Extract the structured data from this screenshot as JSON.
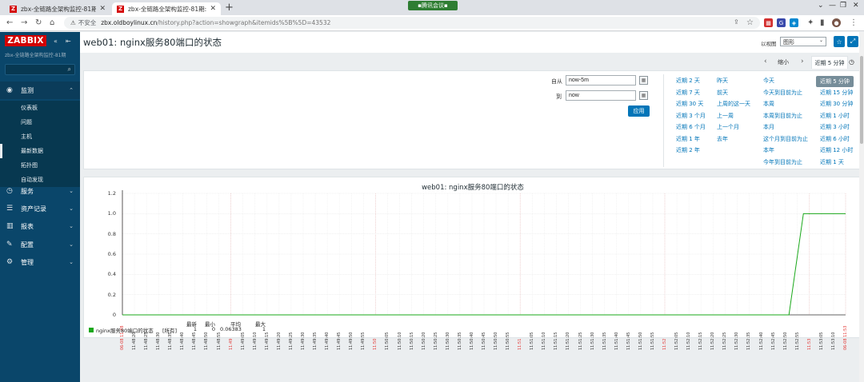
{
  "browser": {
    "tabs": [
      {
        "title": "zbx-全链路全架构监控-81期: 图...",
        "active": false
      },
      {
        "title": "zbx-全链路全架构监控-81期: 图...",
        "active": true
      }
    ],
    "meeting_label": "腾讯会议",
    "insecure_label": "不安全",
    "url_host": "zbx.oldboylinux.cn",
    "url_rest": "/history.php?action=showgraph&itemids%5B%5D=43532",
    "favicon_letter": "Z"
  },
  "sidebar": {
    "logo": "ZABBIX",
    "org": "zbx-全链路全架构监控-81期",
    "menu": [
      {
        "label": "监测",
        "icon": "eye-icon",
        "open": true
      },
      {
        "label": "服务",
        "icon": "clock-icon"
      },
      {
        "label": "资产记录",
        "icon": "list-icon"
      },
      {
        "label": "报表",
        "icon": "bar-chart-icon"
      },
      {
        "label": "配置",
        "icon": "wrench-icon"
      },
      {
        "label": "管理",
        "icon": "gear-icon"
      }
    ],
    "submenu": [
      {
        "label": "仪表板"
      },
      {
        "label": "问题"
      },
      {
        "label": "主机"
      },
      {
        "label": "最新数据",
        "selected": true
      },
      {
        "label": "拓扑图"
      },
      {
        "label": "自动发现"
      }
    ]
  },
  "header": {
    "title": "web01: nginx服务80端口的状态",
    "view_as_label": "以视图",
    "view_as_value": "图形"
  },
  "timenav": {
    "zoom_out": "缩小",
    "active_tab": "近期 5 分钟"
  },
  "filter": {
    "from_label": "自从",
    "from_value": "now-5m",
    "to_label": "到",
    "to_value": "now",
    "apply": "应用",
    "quick_ranges": [
      [
        "近期 2 天",
        "近期 7 天",
        "近期 30 天",
        "近期 3 个月",
        "近期 6 个月",
        "近期 1 年",
        "近期 2 年"
      ],
      [
        "昨天",
        "前天",
        "上周的这一天",
        "上一周",
        "上一个月",
        "去年"
      ],
      [
        "今天",
        "今天到目前为止",
        "本周",
        "本周到目前为止",
        "本月",
        "这个月到目前为止",
        "本年",
        "今年到目前为止"
      ],
      [
        "近期 5 分钟",
        "近期 15 分钟",
        "近期 30 分钟",
        "近期 1 小时",
        "近期 3 小时",
        "近期 6 小时",
        "近期 12 小时",
        "近期 1 天"
      ]
    ],
    "selected_quick": "近期 5 分钟"
  },
  "chart_data": {
    "type": "line",
    "title": "web01: nginx服务80端口的状态",
    "ylim": [
      0,
      1.2
    ],
    "yticks": [
      "1.2",
      "1.0",
      "0.8",
      "0.6",
      "0.4",
      "0.2",
      "0"
    ],
    "x_ticks": [
      "06-08 11:48",
      "11:48:20",
      "11:48:25",
      "11:48:30",
      "11:48:35",
      "11:48:40",
      "11:48:45",
      "11:48:50",
      "11:48:55",
      "11:49",
      "11:49:05",
      "11:49:10",
      "11:49:15",
      "11:49:20",
      "11:49:25",
      "11:49:30",
      "11:49:35",
      "11:49:40",
      "11:49:45",
      "11:49:50",
      "11:49:55",
      "11:50",
      "11:50:05",
      "11:50:10",
      "11:50:15",
      "11:50:20",
      "11:50:25",
      "11:50:30",
      "11:50:35",
      "11:50:40",
      "11:50:45",
      "11:50:50",
      "11:50:55",
      "11:51",
      "11:51:05",
      "11:51:10",
      "11:51:15",
      "11:51:20",
      "11:51:25",
      "11:51:30",
      "11:51:35",
      "11:51:40",
      "11:51:45",
      "11:51:50",
      "11:51:55",
      "11:52",
      "11:52:05",
      "11:52:10",
      "11:52:15",
      "11:52:20",
      "11:52:25",
      "11:52:30",
      "11:52:35",
      "11:52:40",
      "11:52:45",
      "11:52:50",
      "11:52:55",
      "11:53",
      "11:53:05",
      "11:53:10",
      "06-08 11:53"
    ],
    "red_ticks": [
      0,
      9,
      21,
      33,
      45,
      57,
      60
    ],
    "series": [
      {
        "name": "nginx服务80端口的状态",
        "color": "#1aa81a",
        "x_index": [
          0,
          55.3,
          56.5,
          60
        ],
        "values": [
          0,
          0,
          1,
          1
        ]
      }
    ],
    "legend": {
      "name": "nginx服务80端口的状态",
      "func": "[所有]",
      "headers": [
        "最新",
        "最小",
        "平均",
        "最大"
      ],
      "values": [
        "1",
        "0",
        "0.06383",
        "1"
      ]
    },
    "grid": true
  }
}
